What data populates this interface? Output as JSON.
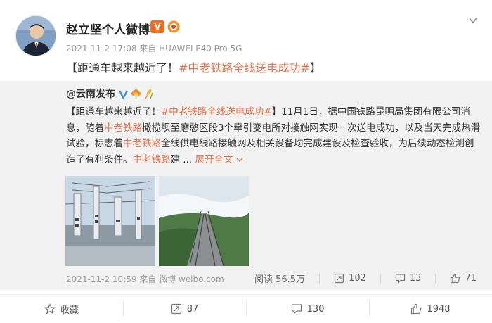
{
  "post": {
    "author": "赵立坚个人微博",
    "timestamp": "2021-11-2 17:08",
    "source": "来自 HUAWEI P40 Pro 5G",
    "text_prefix": "【距通车越来越近了！",
    "hashtag": "#中老铁路全线送电成功#",
    "text_suffix": "】"
  },
  "repost": {
    "author": "@云南发布",
    "text": {
      "p1": "【距通车越来越近了！",
      "hashtag": "#中老铁路全线送电成功#",
      "p2": "】11月1日，据中国铁路昆明局集团有限公司消息，随着",
      "link1": "中老铁路",
      "p3": "橄榄坝至磨憨区段3个牵引变电所对接触网实现一次送电成功，以及当天完成热滑试验，标志着",
      "link2": "中老铁路",
      "p4": "全线供电线路接触网及相关设备均完成建设及检查验收，为后续动态检测创造了有利条件。",
      "link3": "中老铁路",
      "p5": "建 ...",
      "expand": "展开全文"
    },
    "timestamp": "2021-11-2 10:59",
    "source": "来自 微博 weibo.com",
    "stats": {
      "reads": "阅读 56.5万",
      "reposts": "102",
      "comments": "13",
      "likes": "71"
    }
  },
  "actions": {
    "favorite": "收藏",
    "repost": "87",
    "comment": "130",
    "like": "1948"
  },
  "colors": {
    "accent": "#eb7350",
    "verified": "#f26f1f",
    "repost_bg": "#f2f2f2"
  }
}
